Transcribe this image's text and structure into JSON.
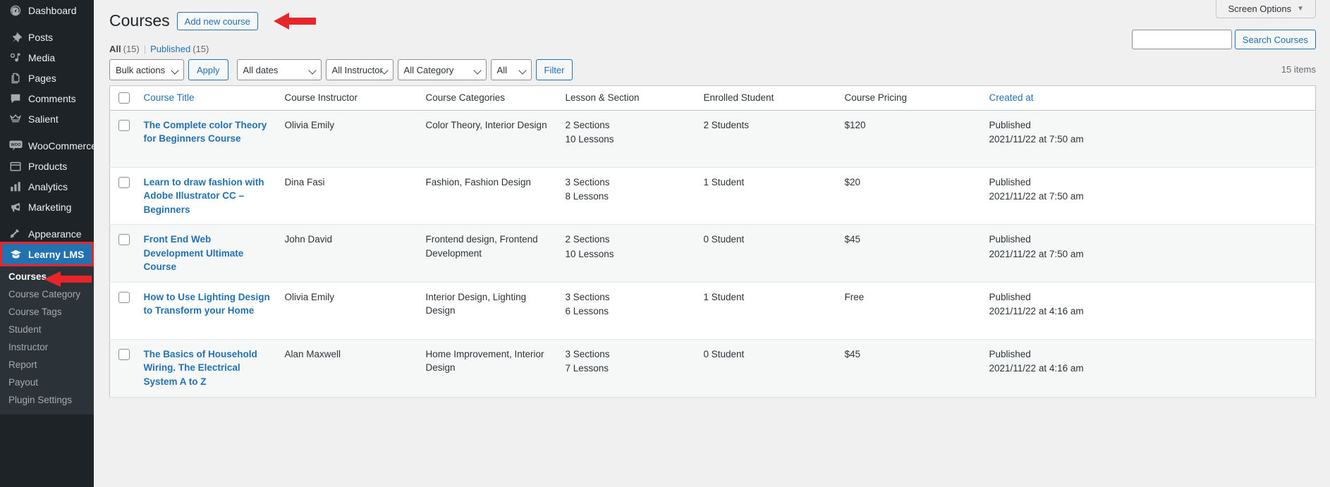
{
  "sidebar": {
    "items": [
      {
        "label": "Dashboard",
        "icon": "dashboard-icon"
      },
      {
        "label": "Posts",
        "icon": "pin-icon",
        "group_start": true
      },
      {
        "label": "Media",
        "icon": "media-icon"
      },
      {
        "label": "Pages",
        "icon": "pages-icon"
      },
      {
        "label": "Comments",
        "icon": "comments-icon"
      },
      {
        "label": "Salient",
        "icon": "crown-icon"
      },
      {
        "label": "WooCommerce",
        "icon": "woocommerce-icon",
        "group_start": true
      },
      {
        "label": "Products",
        "icon": "products-icon"
      },
      {
        "label": "Analytics",
        "icon": "analytics-icon"
      },
      {
        "label": "Marketing",
        "icon": "marketing-icon"
      },
      {
        "label": "Appearance",
        "icon": "appearance-icon",
        "group_start": true
      },
      {
        "label": "Learny LMS",
        "icon": "graduation-cap-icon",
        "current": true
      }
    ],
    "submenu": [
      {
        "label": "Courses",
        "current": true
      },
      {
        "label": "Course Category"
      },
      {
        "label": "Course Tags"
      },
      {
        "label": "Student"
      },
      {
        "label": "Instructor"
      },
      {
        "label": "Report"
      },
      {
        "label": "Payout"
      },
      {
        "label": "Plugin Settings"
      }
    ]
  },
  "screen_meta": {
    "screen_options_label": "Screen Options"
  },
  "header": {
    "title": "Courses",
    "add_new_label": "Add new course"
  },
  "views": {
    "all_label": "All",
    "all_count": "(15)",
    "separator": "|",
    "published_label": "Published",
    "published_count": "(15)"
  },
  "search": {
    "value": "",
    "placeholder": "",
    "submit_label": "Search Courses"
  },
  "tablenav": {
    "bulk_actions": "Bulk actions",
    "apply_label": "Apply",
    "all_dates": "All dates",
    "all_instructor": "All Instructor",
    "all_category": "All Category",
    "all": "All",
    "filter_label": "Filter",
    "displaying_num": "15 items"
  },
  "table": {
    "columns": [
      {
        "key": "cb",
        "label": ""
      },
      {
        "key": "title",
        "label": "Course Title",
        "sortable": true
      },
      {
        "key": "instructor",
        "label": "Course Instructor",
        "sortable": false
      },
      {
        "key": "categories",
        "label": "Course Categories",
        "sortable": false
      },
      {
        "key": "lesson",
        "label": "Lesson & Section",
        "sortable": false
      },
      {
        "key": "students",
        "label": "Enrolled Student",
        "sortable": false
      },
      {
        "key": "pricing",
        "label": "Course Pricing",
        "sortable": false
      },
      {
        "key": "created",
        "label": "Created at",
        "sortable": true
      }
    ],
    "rows": [
      {
        "title": "The Complete color Theory for Beginners Course",
        "instructor": "Olivia Emily",
        "categories": "Color Theory, Interior Design",
        "sections": "2 Sections",
        "lessons": "10 Lessons",
        "students": "2 Students",
        "pricing": "$120",
        "created_status": "Published",
        "created_date": "2021/11/22 at 7:50 am"
      },
      {
        "title": "Learn to draw fashion with Adobe Illustrator CC – Beginners",
        "instructor": "Dina Fasi",
        "categories": "Fashion, Fashion Design",
        "sections": "3 Sections",
        "lessons": "8 Lessons",
        "students": "1 Student",
        "pricing": "$20",
        "created_status": "Published",
        "created_date": "2021/11/22 at 7:50 am"
      },
      {
        "title": "Front End Web Development Ultimate Course",
        "instructor": "John David",
        "categories": "Frontend design, Frontend Development",
        "sections": "2 Sections",
        "lessons": "10 Lessons",
        "students": "0 Student",
        "pricing": "$45",
        "created_status": "Published",
        "created_date": "2021/11/22 at 7:50 am"
      },
      {
        "title": "How to Use Lighting Design to Transform your Home",
        "instructor": "Olivia Emily",
        "categories": "Interior Design, Lighting Design",
        "sections": "3 Sections",
        "lessons": "6 Lessons",
        "students": "1 Student",
        "pricing": "Free",
        "created_status": "Published",
        "created_date": "2021/11/22 at 4:16 am"
      },
      {
        "title": "The Basics of Household Wiring. The Electrical System A to Z",
        "instructor": "Alan Maxwell",
        "categories": "Home Improvement, Interior Design",
        "sections": "3 Sections",
        "lessons": "7 Lessons",
        "students": "0 Student",
        "pricing": "$45",
        "created_status": "Published",
        "created_date": "2021/11/22 at 4:16 am"
      }
    ]
  },
  "colors": {
    "sidebar_bg": "#1d2327",
    "submenu_bg": "#2c3338",
    "accent_blue": "#2271b1",
    "annotation_red": "#e8262a"
  }
}
